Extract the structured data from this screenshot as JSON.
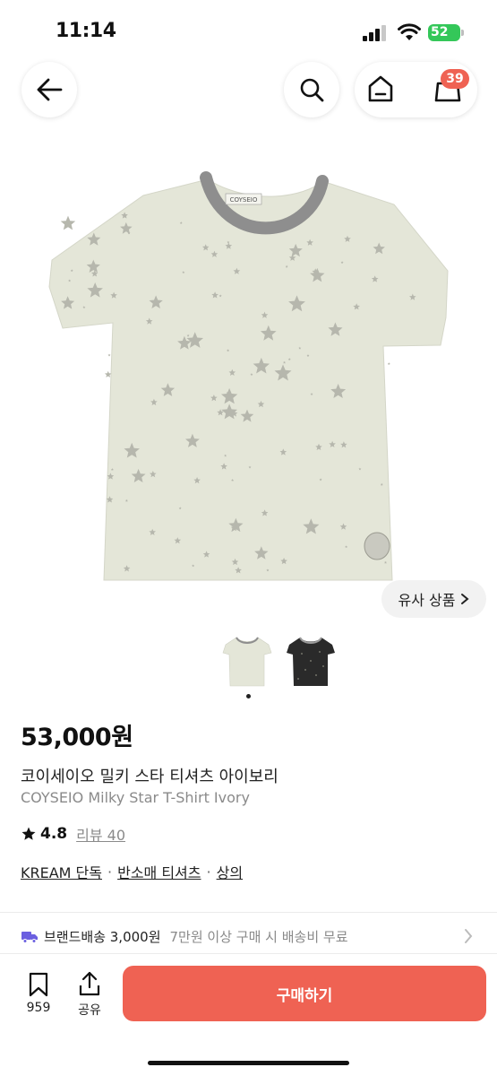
{
  "status_bar": {
    "time": "11:14",
    "battery": "52"
  },
  "header": {
    "cart_count": "39"
  },
  "product_image": {
    "logo_text": "COYSEIO",
    "background": "#e4e6d8",
    "collar": "#8e8e8e",
    "star": "#b6b7ad"
  },
  "similar": {
    "label": "유사 상품"
  },
  "product": {
    "price": "53,000원",
    "name_kr": "코이세이오 밀키 스타 티셔츠 아이보리",
    "name_en": "COYSEIO Milky Star T-Shirt Ivory",
    "rating": "4.8",
    "review": "리뷰 40",
    "tags": [
      "KREAM 단독",
      "반소매 티셔츠",
      "상의"
    ]
  },
  "shipping": {
    "label": "브랜드배송 3,000원",
    "condition": "7만원 이상 구매 시 배송비 무료"
  },
  "bottom": {
    "bookmark_count": "959",
    "share_label": "공유",
    "buy_label": "구매하기",
    "buy_color": "#ef6253"
  }
}
